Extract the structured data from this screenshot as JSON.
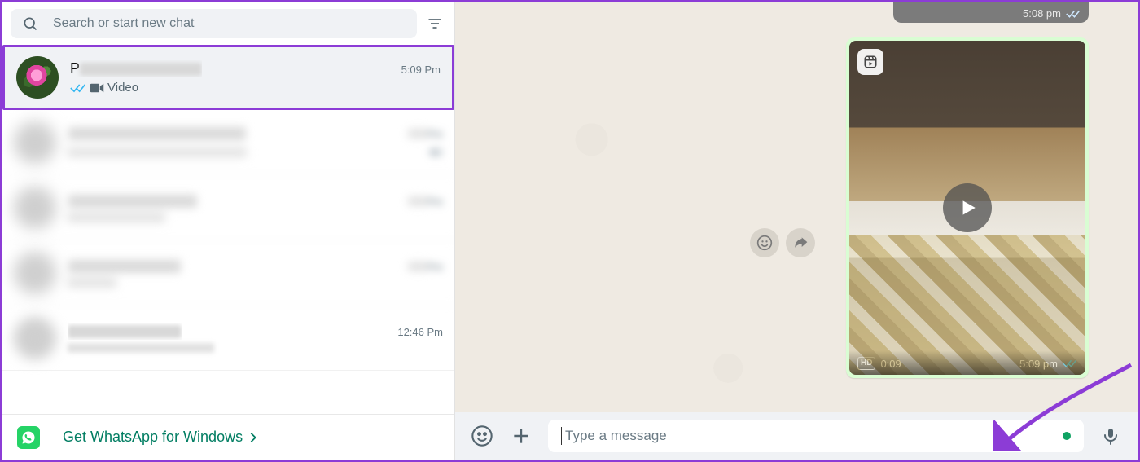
{
  "search": {
    "placeholder": "Search or start new chat"
  },
  "chats": [
    {
      "name_prefix": "P",
      "time": "5:09 Pm",
      "subtitle": "Video"
    },
    {
      "time_suffix": "Pm"
    },
    {
      "time_suffix": "Pm"
    },
    {
      "time_suffix": "Pm"
    },
    {
      "time": "12:46 Pm"
    }
  ],
  "promo": {
    "text": "Get WhatsApp for Windows"
  },
  "prev_message": {
    "time": "5:08 pm"
  },
  "video_message": {
    "duration": "0:09",
    "time": "5:09 pm",
    "hd_label": "HD"
  },
  "composer": {
    "placeholder": "Type a message"
  }
}
